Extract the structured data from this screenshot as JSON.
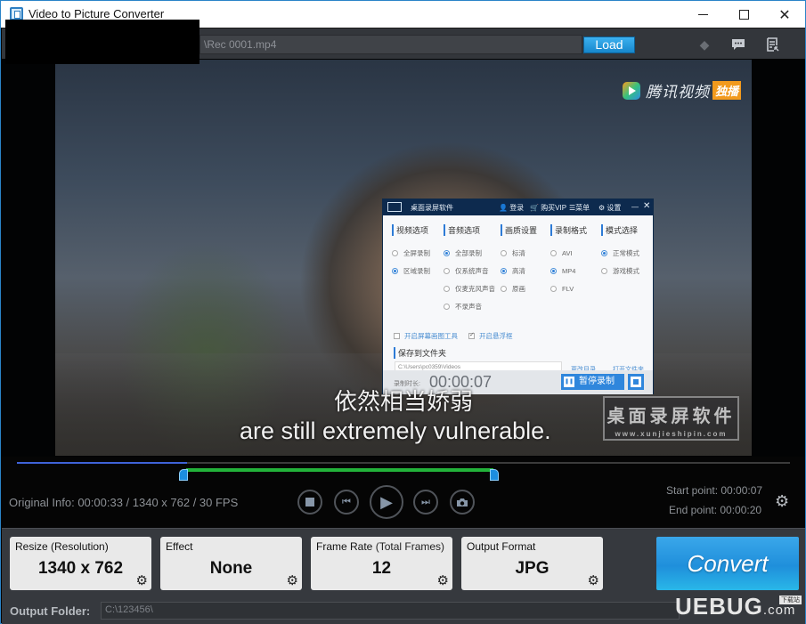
{
  "window": {
    "title": "Video to Picture Converter",
    "controls": {
      "minimize": "minimize",
      "maximize": "maximize",
      "close": "close"
    }
  },
  "toolbar": {
    "file_path": "\\Rec 0001.mp4",
    "load_label": "Load",
    "icons": [
      "tag-icon",
      "chat-icon",
      "list-icon"
    ]
  },
  "video": {
    "brand_logo_text": "腾讯视频",
    "brand_badge": "独播",
    "subtitle_cn": "依然相当娇弱",
    "subtitle_en": "are still extremely vulnerable.",
    "watermark_title": "桌面录屏软件",
    "watermark_url": "www.xunjieshipin.com"
  },
  "recorder": {
    "title": "桌面录屏软件",
    "menu": {
      "login": "登录",
      "buy_vip": "购买VIP",
      "menu": "菜单",
      "settings": "设置"
    },
    "columns": [
      {
        "header": "视频选项",
        "options": [
          {
            "label": "全屏录制",
            "selected": false
          },
          {
            "label": "区域录制",
            "selected": true
          }
        ]
      },
      {
        "header": "音频选项",
        "options": [
          {
            "label": "全部录制",
            "selected": true
          },
          {
            "label": "仅系统声音",
            "selected": false
          },
          {
            "label": "仅麦克风声音",
            "selected": false
          },
          {
            "label": "不录声音",
            "selected": false
          }
        ]
      },
      {
        "header": "画质设置",
        "options": [
          {
            "label": "标清",
            "selected": false
          },
          {
            "label": "高清",
            "selected": true
          },
          {
            "label": "原画",
            "selected": false
          }
        ]
      },
      {
        "header": "录制格式",
        "options": [
          {
            "label": "AVI",
            "selected": false
          },
          {
            "label": "MP4",
            "selected": true
          },
          {
            "label": "FLV",
            "selected": false
          }
        ]
      },
      {
        "header": "模式选择",
        "options": [
          {
            "label": "正常模式",
            "selected": true
          },
          {
            "label": "游戏模式",
            "selected": false
          }
        ]
      }
    ],
    "check_draw_tool": {
      "label": "开启屏幕画图工具",
      "checked": false
    },
    "check_float": {
      "label": "开启悬浮框",
      "checked": true
    },
    "save_header": "保存到文件夹",
    "save_path": "C:\\Users\\pc0359\\Videos",
    "change_dir": "更改目录",
    "open_folder": "打开文件夹",
    "duration_label": "录制时长:",
    "duration": "00:00:07",
    "pause_label": "暂停录制"
  },
  "timeline": {
    "playhead_fraction": 0.22,
    "selection_start": "00:00:07",
    "selection_end": "00:00:20"
  },
  "info": {
    "original": "Original Info: 00:00:33 / 1340 x 762 / 30 FPS",
    "start_point": "Start point: 00:00:07",
    "end_point": "End point: 00:00:20"
  },
  "settings": {
    "resize": {
      "label": "Resize (Resolution)",
      "value": "1340 x 762"
    },
    "effect": {
      "label": "Effect",
      "value": "None"
    },
    "frame_rate": {
      "label": "Frame Rate",
      "label_sub": " (Total Frames)",
      "value": "12"
    },
    "output_format": {
      "label": "Output Format",
      "value": "JPG"
    },
    "convert_label": "Convert"
  },
  "output": {
    "label": "Output Folder:",
    "path": "C:\\123456\\"
  },
  "watermark_site": {
    "main": "UEBUG",
    "suffix": ".com",
    "tag": "下载站"
  },
  "colors": {
    "accent": "#1f8fdb",
    "selection": "#22b33a",
    "playhead": "#3f63d8"
  }
}
